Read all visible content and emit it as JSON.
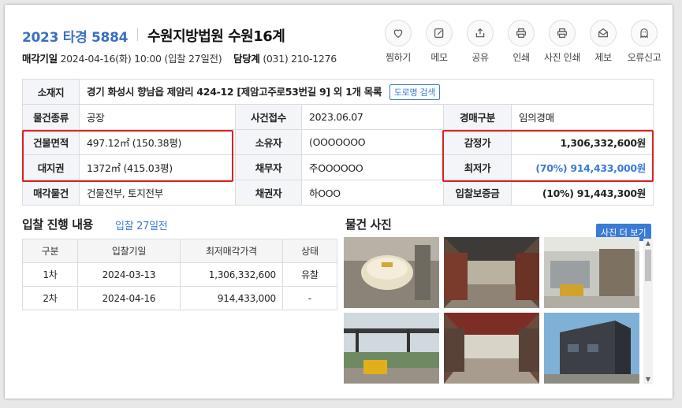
{
  "header": {
    "case_no": "2023 타경 5884",
    "court": "수원지방법원 수원16계",
    "sale_date_label": "매각기일",
    "sale_date_value": "2024-04-16(화) 10:00 (입찰 27일전)",
    "dept_label": "담당계",
    "dept_value": "(031) 210-1276"
  },
  "actions": [
    {
      "label": "찜하기",
      "icon": "heart-icon"
    },
    {
      "label": "메모",
      "icon": "memo-icon"
    },
    {
      "label": "공유",
      "icon": "share-icon"
    },
    {
      "label": "인쇄",
      "icon": "print-icon"
    },
    {
      "label": "사진 인쇄",
      "icon": "photo-print-icon"
    },
    {
      "label": "제보",
      "icon": "report-mail-icon"
    },
    {
      "label": "오류신고",
      "icon": "error-report-icon"
    }
  ],
  "info": {
    "address_label": "소재지",
    "address_value": "경기 화성시 향남읍 제암리 424-12 [제암고주로53번길 9] 외 1개 목록",
    "road_btn": "도로명 검색",
    "type_label": "물건종류",
    "type_value": "공장",
    "receipt_label": "사건접수",
    "receipt_value": "2023.06.07",
    "auction_kind_label": "경매구분",
    "auction_kind_value": "임의경매",
    "building_area_label": "건물면적",
    "building_area_value": "497.12㎡ (150.38평)",
    "owner_label": "소유자",
    "owner_value": "(OOOOOOO",
    "appraisal_label": "감정가",
    "appraisal_value": "1,306,332,600원",
    "land_label": "대지권",
    "land_value": "1372㎡ (415.03평)",
    "debtor_label": "채무자",
    "debtor_value": "주OOOOOO",
    "min_price_label": "최저가",
    "min_price_value": "(70%) 914,433,000원",
    "sale_items_label": "매각물건",
    "sale_items_value": "건물전부, 토지전부",
    "creditor_label": "채권자",
    "creditor_value": "하OOO",
    "deposit_label": "입찰보증금",
    "deposit_value": "(10%) 91,443,300원"
  },
  "bid_section": {
    "title": "입찰 진행 내용",
    "subtitle": "입찰 27일전",
    "columns": [
      "구분",
      "입찰기일",
      "최저매각가격",
      "상태"
    ],
    "rows": [
      {
        "round": "1차",
        "date": "2024-03-13",
        "price": "1,306,332,600",
        "status": "유찰"
      },
      {
        "round": "2차",
        "date": "2024-04-16",
        "price": "914,433,000",
        "status": "-"
      }
    ]
  },
  "photo_section": {
    "title": "물건 사진",
    "more_btn": "사진 더 보기",
    "photos": [
      "photo-1",
      "photo-2",
      "photo-3",
      "photo-4",
      "photo-5",
      "photo-6"
    ]
  },
  "colors": {
    "accent": "#3a7bd5",
    "highlight_border": "#e02020",
    "header_cell_bg": "#f3f5f8"
  }
}
